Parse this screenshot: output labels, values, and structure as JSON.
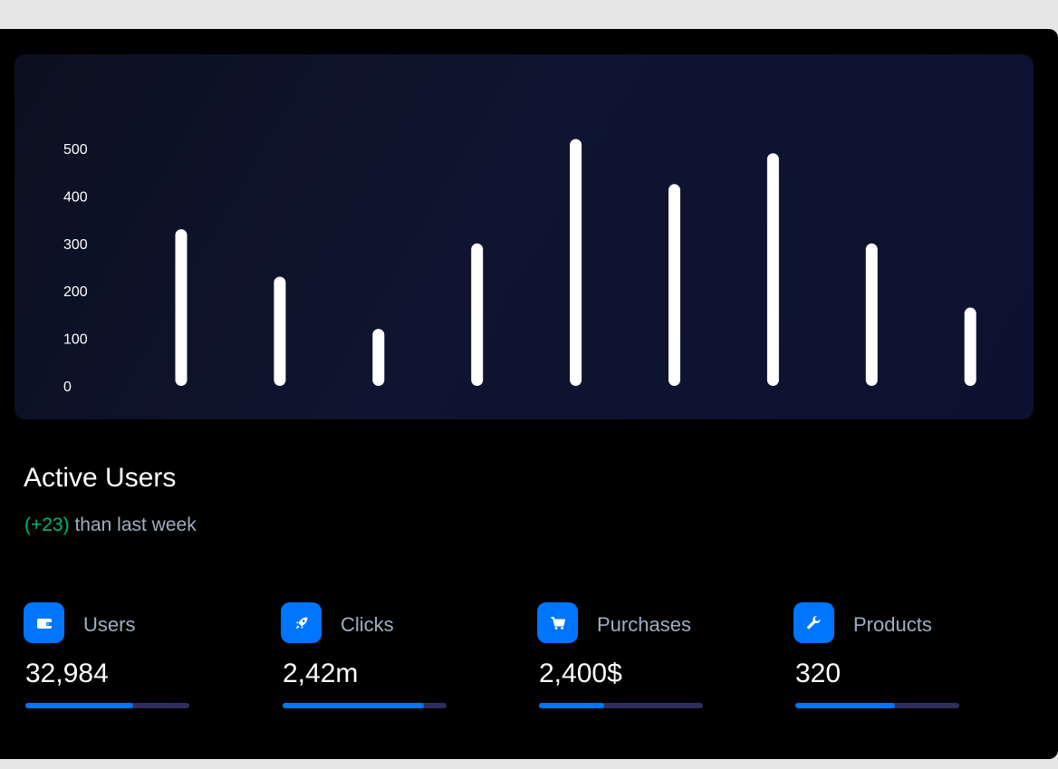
{
  "chart_data": {
    "type": "bar",
    "title": "Active Users",
    "categories": [
      "",
      "",
      "",
      "",
      "",
      "",
      "",
      "",
      ""
    ],
    "values": [
      330,
      230,
      120,
      300,
      520,
      425,
      490,
      300,
      165
    ],
    "ylim": [
      0,
      500
    ],
    "yticks": [
      500,
      400,
      300,
      200,
      100,
      0
    ],
    "grid": false,
    "bar_color": "#ffffff"
  },
  "summary": {
    "title": "Active Users",
    "delta": "(+23)",
    "delta_text": " than last week",
    "delta_color": "#01b574"
  },
  "stats": [
    {
      "label": "Users",
      "value": "32,984",
      "progress": 0.66,
      "icon": "wallet-icon"
    },
    {
      "label": "Clicks",
      "value": "2,42m",
      "progress": 0.86,
      "icon": "rocket-icon"
    },
    {
      "label": "Purchases",
      "value": "2,400$",
      "progress": 0.4,
      "icon": "cart-icon"
    },
    {
      "label": "Products",
      "value": "320",
      "progress": 0.61,
      "icon": "wrench-icon"
    }
  ],
  "colors": {
    "accent": "#0075ff",
    "track": "#2d2e5f",
    "card": "#000000"
  }
}
